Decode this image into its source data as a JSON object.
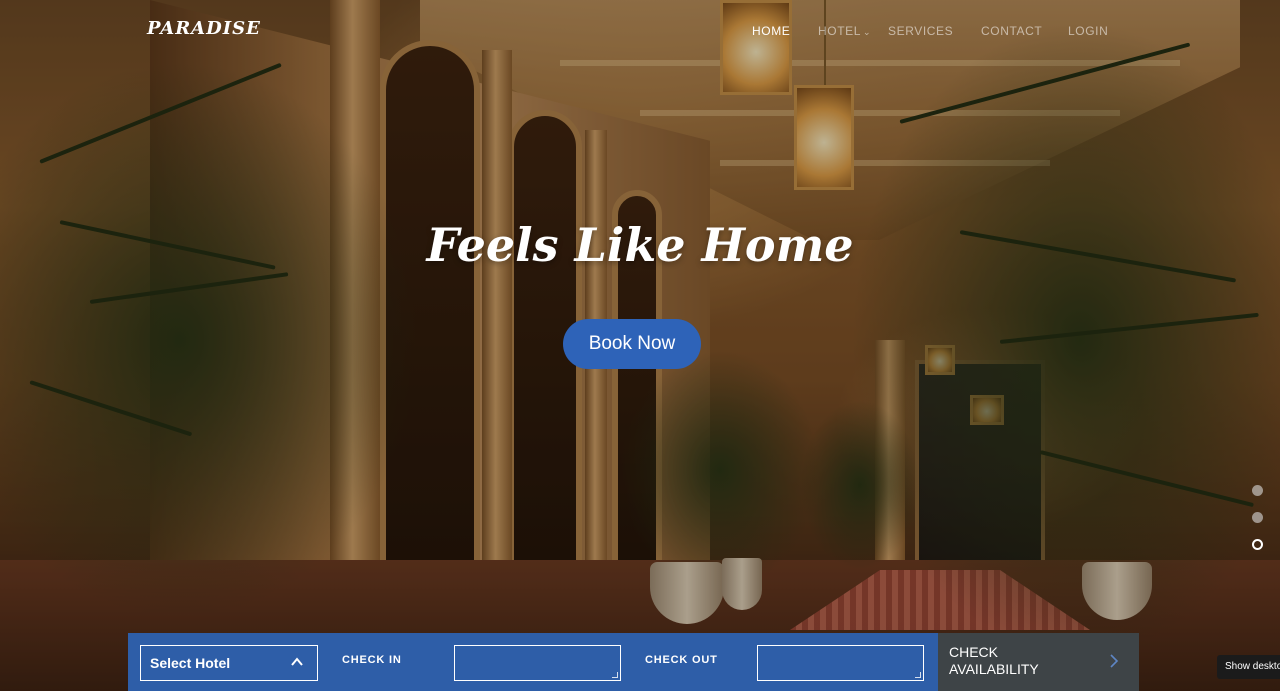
{
  "brand": "PARADISE",
  "nav": {
    "items": [
      {
        "label": "HOME",
        "active": true
      },
      {
        "label": "HOTEL",
        "has_dropdown": true
      },
      {
        "label": "SERVICES"
      },
      {
        "label": "CONTACT"
      },
      {
        "label": "LOGIN"
      }
    ],
    "dropdown_icon": "chevron-down-icon"
  },
  "hero": {
    "title": "Feels Like Home",
    "cta_label": "Book Now"
  },
  "slider": {
    "dot_count": 3,
    "active_index": 2
  },
  "booking": {
    "select_hotel_label": "Select Hotel",
    "select_icon": "chevron-up-icon",
    "check_in_label": "CHECK IN",
    "check_in_value": "",
    "check_out_label": "CHECK OUT",
    "check_out_value": "",
    "check_availability_line1": "CHECK",
    "check_availability_line2": "AVAILABILITY",
    "arrow_icon": "chevron-right-icon"
  },
  "desktop_tip": "Show desktop",
  "colors": {
    "accent": "#2e63b8",
    "booking_bar": "#2e5ea8",
    "check_button": "#3e4447"
  }
}
